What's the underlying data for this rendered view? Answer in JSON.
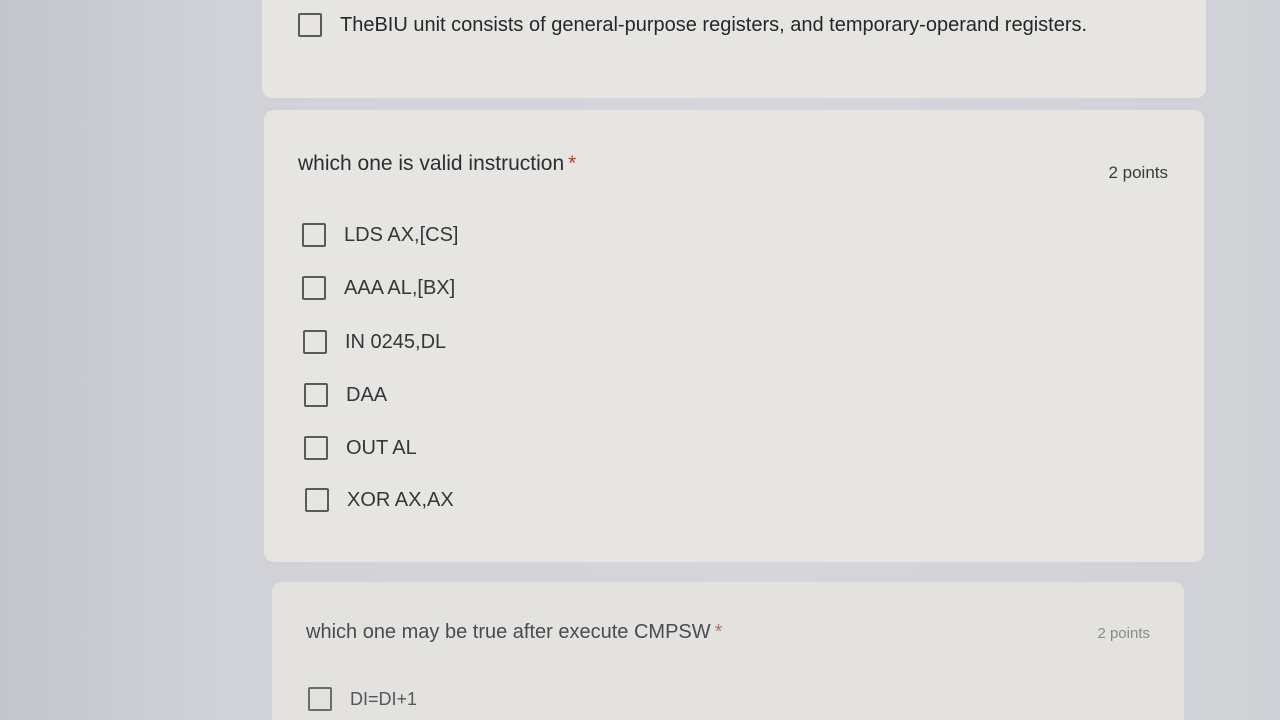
{
  "question_1": {
    "options": [
      {
        "label": "TheBIU unit consists of general-purpose registers, and temporary-operand registers."
      }
    ]
  },
  "question_2": {
    "title": "which one is valid instruction",
    "required_mark": "*",
    "points": "2 points",
    "options": [
      {
        "label": "LDS AX,[CS]"
      },
      {
        "label": "AAA AL,[BX]"
      },
      {
        "label": "IN 0245,DL"
      },
      {
        "label": "DAA"
      },
      {
        "label": "OUT AL"
      },
      {
        "label": "XOR AX,AX"
      }
    ]
  },
  "question_3": {
    "title": "which one may be true after execute CMPSW",
    "required_mark": "*",
    "points": "2 points",
    "options": [
      {
        "label": "DI=DI+1"
      }
    ]
  },
  "colors": {
    "card_background": "#e6e5e2",
    "page_background": "#d0d2d8",
    "required_star": "#c0392b",
    "checkbox_border": "#5a5a5e"
  }
}
